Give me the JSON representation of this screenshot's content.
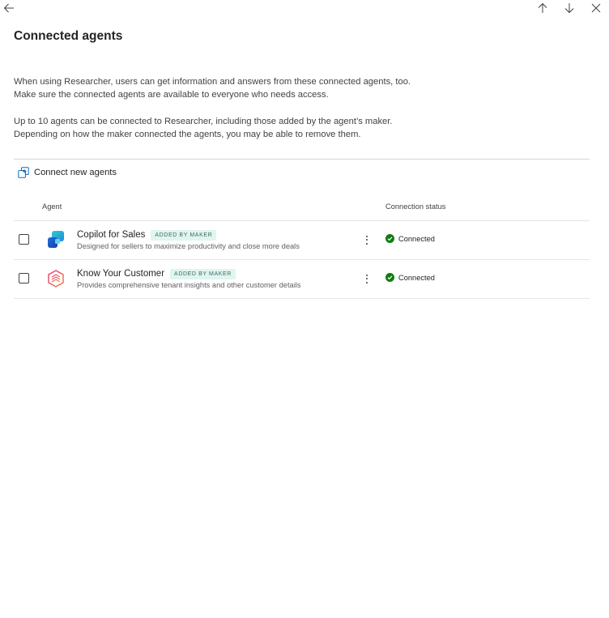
{
  "header": {
    "title": "Connected agents"
  },
  "description": {
    "para1_line1": "When using Researcher, users can get information and answers from these connected agents, too.",
    "para1_line2": "Make sure the connected agents are available to everyone who needs access.",
    "para2_line1": "Up to 10 agents can be connected to Researcher, including those added by the agent’s maker.",
    "para2_line2": "Depending on how the maker connected the agents, you may be able to remove them."
  },
  "toolbar": {
    "connect_label": "Connect new agents"
  },
  "table": {
    "columns": {
      "agent": "Agent",
      "status": "Connection status"
    },
    "rows": [
      {
        "name": "Copilot for Sales",
        "badge": "ADDED BY MAKER",
        "description": "Designed for sellers to maximize productivity and close more deals",
        "status": "Connected",
        "icon": "copilot-sales-icon"
      },
      {
        "name": "Know Your Customer",
        "badge": "ADDED BY MAKER",
        "description": "Provides comprehensive tenant insights and other customer details",
        "status": "Connected",
        "icon": "know-your-customer-icon"
      }
    ]
  },
  "colors": {
    "accent": "#0f6cbd",
    "status_ok": "#107c10",
    "badge_bg": "#e0f5f0",
    "badge_text": "#3d6b5f"
  }
}
